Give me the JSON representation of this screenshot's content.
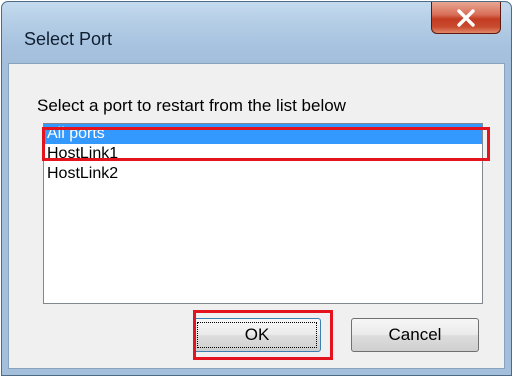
{
  "window": {
    "title": "Select Port"
  },
  "dialog": {
    "prompt": "Select a port to restart from the list below",
    "ports": [
      "All ports",
      "HostLink1",
      "HostLink2"
    ],
    "selected_port": "All ports",
    "ok_label": "OK",
    "cancel_label": "Cancel"
  },
  "colors": {
    "selection": "#3399ff",
    "highlight_annotation": "#e3141d"
  },
  "icons": {
    "close": "close-icon"
  }
}
